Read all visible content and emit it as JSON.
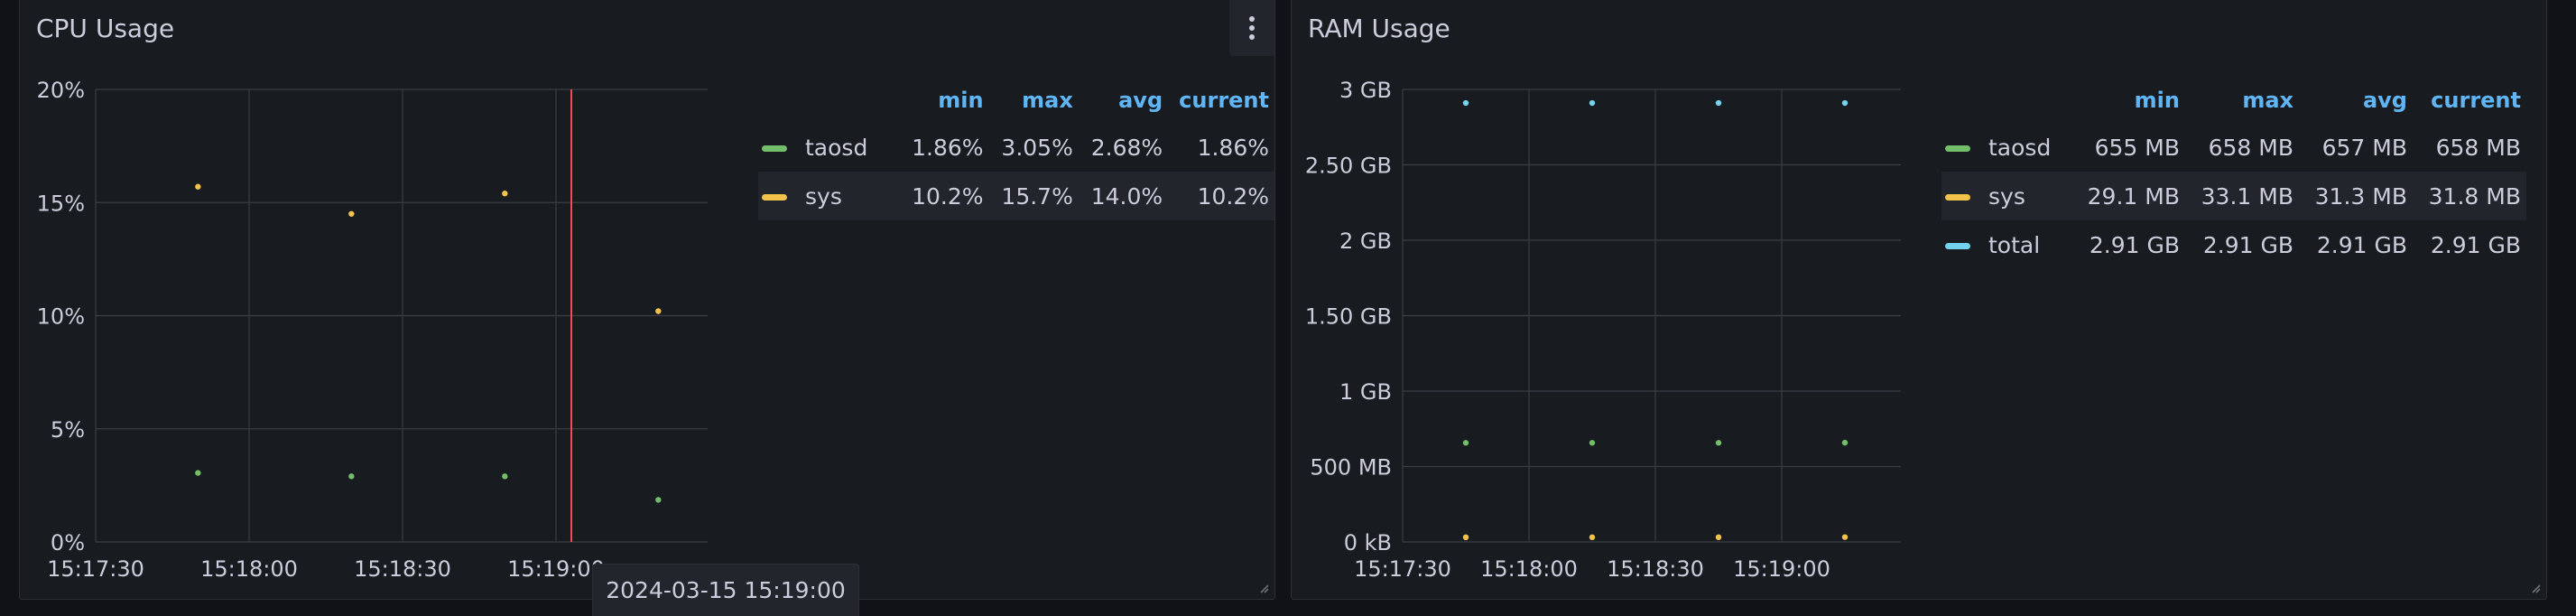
{
  "colors": {
    "taosd": "#73bf69",
    "sys": "#f2c24b",
    "total": "#73d3ee",
    "cursor": "#f2495c",
    "header": "#5fb5f5"
  },
  "cpu_panel": {
    "title": "CPU Usage",
    "menu_icon": "vertical-ellipsis-icon",
    "legend": {
      "headers": [
        "min",
        "max",
        "avg",
        "current"
      ],
      "rows": [
        {
          "name": "taosd",
          "color": "#73bf69",
          "min": "1.86%",
          "max": "3.05%",
          "avg": "2.68%",
          "current": "1.86%"
        },
        {
          "name": "sys",
          "color": "#f2c24b",
          "min": "10.2%",
          "max": "15.7%",
          "avg": "14.0%",
          "current": "10.2%"
        }
      ]
    }
  },
  "ram_panel": {
    "title": "RAM Usage",
    "legend": {
      "headers": [
        "min",
        "max",
        "avg",
        "current"
      ],
      "rows": [
        {
          "name": "taosd",
          "color": "#73bf69",
          "min": "655 MB",
          "max": "658 MB",
          "avg": "657 MB",
          "current": "658 MB"
        },
        {
          "name": "sys",
          "color": "#f2c24b",
          "min": "29.1 MB",
          "max": "33.1 MB",
          "avg": "31.3 MB",
          "current": "31.8 MB"
        },
        {
          "name": "total",
          "color": "#73d3ee",
          "min": "2.91 GB",
          "max": "2.91 GB",
          "avg": "2.91 GB",
          "current": "2.91 GB"
        }
      ]
    }
  },
  "tooltip": {
    "text": "2024-03-15 15:19:00"
  },
  "chart_data": [
    {
      "type": "scatter",
      "title": "CPU Usage",
      "x_ticks": [
        "15:17:30",
        "15:18:00",
        "15:18:30",
        "15:19:00"
      ],
      "y_ticks": [
        "0%",
        "5%",
        "10%",
        "15%",
        "20%"
      ],
      "ylim": [
        0,
        20
      ],
      "xlim_seconds": [
        0,
        120
      ],
      "grid": true,
      "legend_placement": "right",
      "cursor_x_seconds": 93,
      "series": [
        {
          "name": "sys",
          "color": "#f2c24b",
          "points": [
            [
              20,
              15.7
            ],
            [
              50,
              14.5
            ],
            [
              80,
              15.4
            ],
            [
              110,
              10.2
            ]
          ]
        },
        {
          "name": "taosd",
          "color": "#73bf69",
          "points": [
            [
              20,
              3.05
            ],
            [
              50,
              2.9
            ],
            [
              80,
              2.9
            ],
            [
              110,
              1.86
            ]
          ]
        }
      ]
    },
    {
      "type": "scatter",
      "title": "RAM Usage",
      "x_ticks": [
        "15:17:30",
        "15:18:00",
        "15:18:30",
        "15:19:00"
      ],
      "y_ticks": [
        "0 kB",
        "500 MB",
        "1 GB",
        "1.50 GB",
        "2 GB",
        "2.50 GB",
        "3 GB"
      ],
      "ylim": [
        0,
        3
      ],
      "xlim_seconds": [
        0,
        100
      ],
      "grid": true,
      "legend_placement": "right",
      "series": [
        {
          "name": "total",
          "color": "#73d3ee",
          "points": [
            [
              15,
              2.91
            ],
            [
              45,
              2.91
            ],
            [
              75,
              2.91
            ],
            [
              105,
              2.91
            ]
          ]
        },
        {
          "name": "taosd",
          "color": "#73bf69",
          "points": [
            [
              15,
              0.657
            ],
            [
              45,
              0.657
            ],
            [
              75,
              0.657
            ],
            [
              105,
              0.658
            ]
          ]
        },
        {
          "name": "sys",
          "color": "#f2c24b",
          "points": [
            [
              15,
              0.031
            ],
            [
              45,
              0.031
            ],
            [
              75,
              0.031
            ],
            [
              105,
              0.032
            ]
          ]
        }
      ]
    }
  ]
}
